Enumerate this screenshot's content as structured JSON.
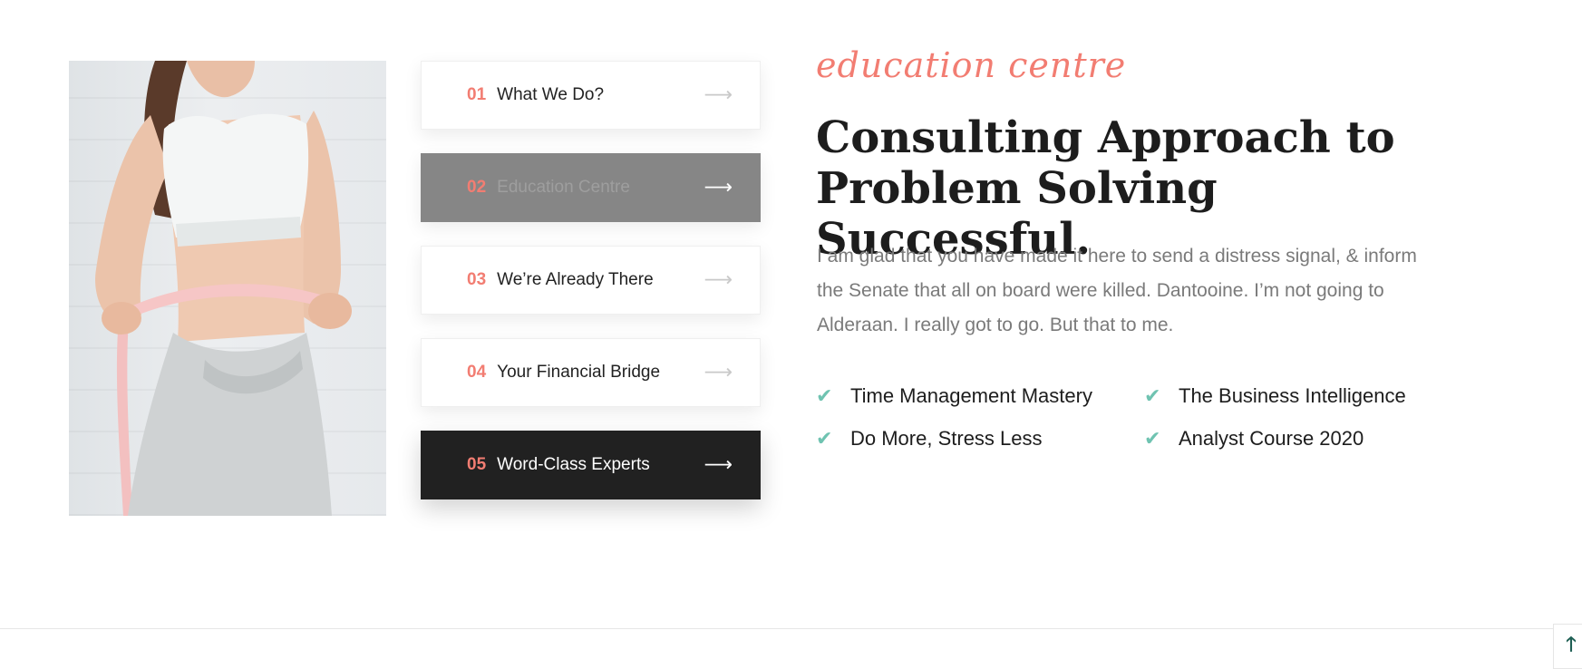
{
  "tabs": [
    {
      "num": "01",
      "label": "What We Do?",
      "arrow": "⟶"
    },
    {
      "num": "02",
      "label": "Education Centre",
      "arrow": "⟶"
    },
    {
      "num": "03",
      "label": "We’re Already There",
      "arrow": "⟶"
    },
    {
      "num": "04",
      "label": "Your Financial Bridge",
      "arrow": "⟶"
    },
    {
      "num": "05",
      "label": "Word-Class Experts",
      "arrow": "⟶"
    }
  ],
  "content": {
    "script_title": "education centre",
    "heading_line1": "Consulting Approach to",
    "heading_line2": "Problem Solving Successful.",
    "paragraph": "I am glad that you have made it here to send a distress signal, & inform the Senate that all on board were killed. Dantooine. I’m not going to Alderaan. I really got to go. But that to me.",
    "features": [
      "Time Management Mastery",
      "The Business Intelligence",
      "Do More, Stress Less",
      "Analyst Course 2020"
    ],
    "check_icon": "✔"
  },
  "back_to_top": {
    "icon": "🡑"
  },
  "colors": {
    "accent": "#f27d72",
    "check": "#6fc3b1",
    "dark": "#212121",
    "hover_gray": "#868686"
  }
}
